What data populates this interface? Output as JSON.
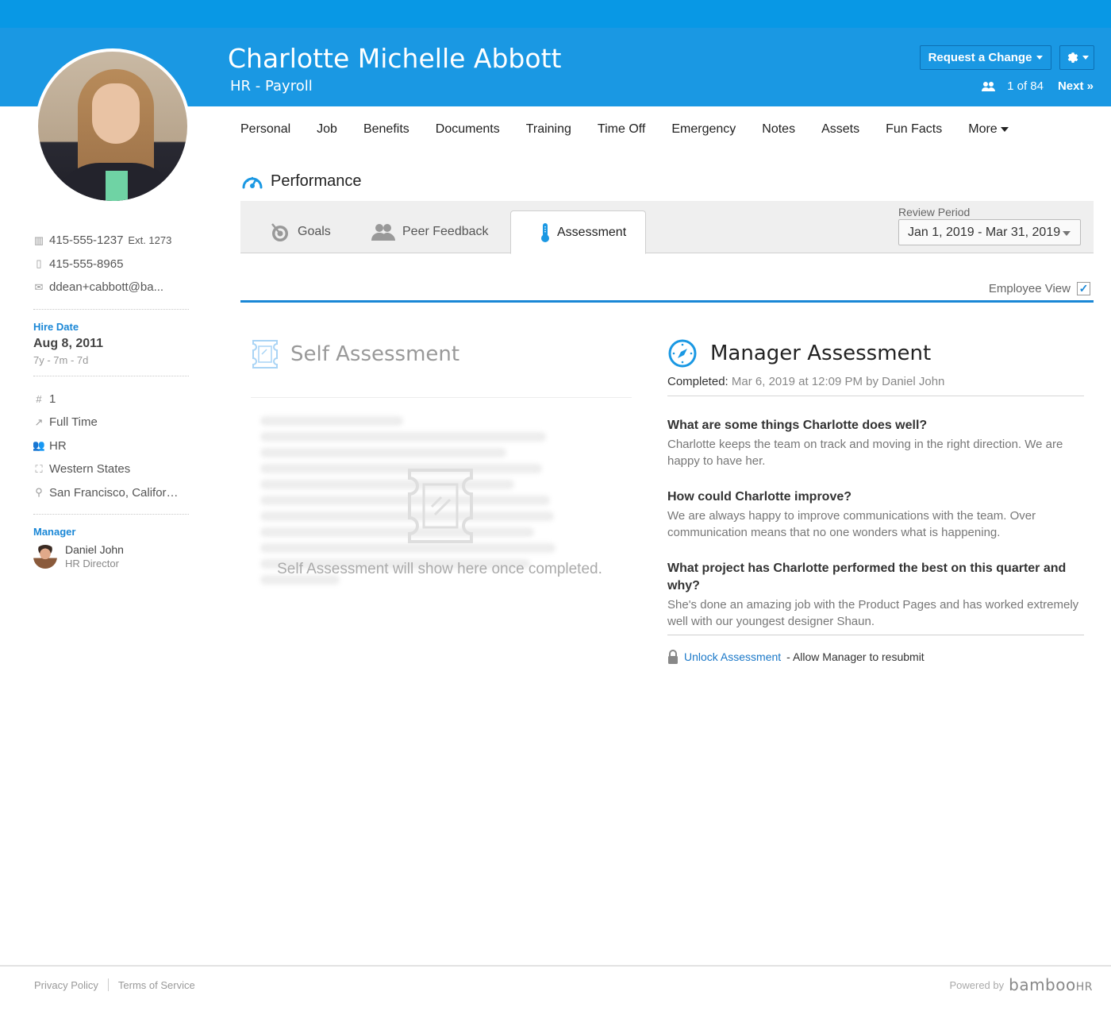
{
  "header": {
    "employee_name": "Charlotte Michelle Abbott",
    "department": "HR - Payroll",
    "request_change_label": "Request a Change",
    "pager_count": "1 of 84",
    "next_label": "Next »",
    "colors": {
      "topbar": "#0898e5",
      "header": "#1a98e3",
      "accent": "#1a87d6"
    }
  },
  "sidebar": {
    "work_phone": "415-555-1237",
    "work_ext": "Ext. 1273",
    "mobile_phone": "415-555-8965",
    "email": "ddean+cabbott@ba...",
    "hire_date_label": "Hire Date",
    "hire_date": "Aug 8, 2011",
    "tenure": "7y - 7m - 7d",
    "employee_number": "1",
    "employment_type": "Full Time",
    "department": "HR",
    "division": "Western States",
    "location": "San Francisco, Califor…",
    "manager_label": "Manager",
    "manager_name": "Daniel John",
    "manager_title": "HR Director"
  },
  "nav": {
    "items": [
      {
        "label": "Personal"
      },
      {
        "label": "Job"
      },
      {
        "label": "Benefits"
      },
      {
        "label": "Documents"
      },
      {
        "label": "Training"
      },
      {
        "label": "Time Off"
      },
      {
        "label": "Emergency"
      },
      {
        "label": "Notes"
      },
      {
        "label": "Assets"
      },
      {
        "label": "Fun Facts"
      },
      {
        "label": "More"
      }
    ]
  },
  "performance": {
    "title": "Performance",
    "tabs": [
      {
        "label": "Goals",
        "icon": "target-icon"
      },
      {
        "label": "Peer Feedback",
        "icon": "people-icon"
      },
      {
        "label": "Assessment",
        "icon": "thermometer-icon",
        "active": true
      }
    ],
    "review_period_label": "Review Period",
    "review_period_value": "Jan 1, 2019 - Mar 31, 2019",
    "employee_view_label": "Employee View",
    "employee_view_checked": true
  },
  "self_assessment": {
    "title": "Self Assessment",
    "empty_message": "Self Assessment will show here once completed."
  },
  "manager_assessment": {
    "title": "Manager Assessment",
    "completed_label": "Completed:",
    "completed_value": "Mar 6, 2019 at 12:09 PM by Daniel John",
    "questions": [
      {
        "question": "What are some things Charlotte does well?",
        "answer": "Charlotte keeps the team on track and moving in the right direction. We are happy to have her."
      },
      {
        "question": "How could Charlotte improve?",
        "answer": "We are always happy to improve communications with the team. Over communication means that no one wonders what is happening."
      },
      {
        "question": "What project has Charlotte performed the best on this quarter and why?",
        "answer": "She's done an amazing job with the Product Pages and has worked extremely well with our youngest designer Shaun."
      }
    ],
    "unlock_link": "Unlock Assessment",
    "unlock_suffix": "- Allow Manager to resubmit"
  },
  "footer": {
    "privacy_label": "Privacy Policy",
    "terms_label": "Terms of Service",
    "powered_by": "Powered by",
    "brand": "bamboo",
    "brand_suffix": "HR"
  }
}
